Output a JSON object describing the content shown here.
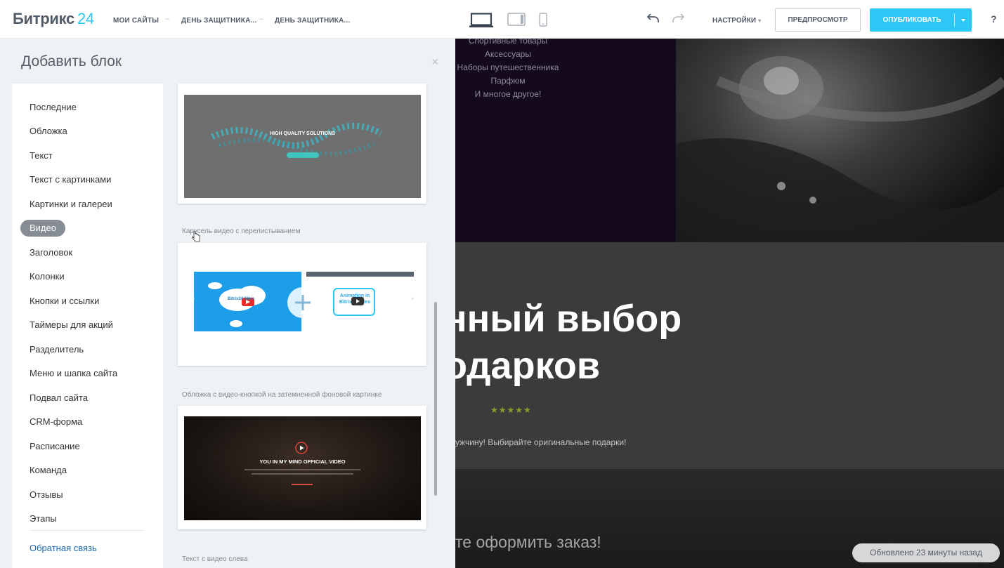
{
  "header": {
    "brand_name": "Битрикс",
    "brand_suffix": "24",
    "breadcrumbs": [
      "МОИ САЙТЫ",
      "ДЕНЬ ЗАЩИТНИКА...",
      "ДЕНЬ ЗАЩИТНИКА..."
    ],
    "settings_label": "НАСТРОЙКИ",
    "preview_label": "ПРЕДПРОСМОТР",
    "publish_label": "ОПУБЛИКОВАТЬ",
    "help_label": "?",
    "devices": [
      "desktop-icon",
      "tablet-icon",
      "mobile-icon"
    ]
  },
  "panel": {
    "title": "Добавить блок",
    "close": "×",
    "categories": [
      "Последние",
      "Обложка",
      "Текст",
      "Текст с картинками",
      "Картинки и галереи",
      "Видео",
      "Заголовок",
      "Колонки",
      "Кнопки и ссылки",
      "Таймеры для акций",
      "Разделитель",
      "Меню и шапка сайта",
      "Подвал сайта",
      "CRM-форма",
      "Расписание",
      "Команда",
      "Отзывы",
      "Этапы"
    ],
    "active_category": "Видео",
    "feedback": "Обратная связь",
    "blocks": [
      {
        "title": "",
        "preview_heading": "HIGH QUALITY SOLUTIONS"
      },
      {
        "title": "Карусель видео с перелистыванием",
        "slide1": "Bitrix24 Sites",
        "slide2_line1": "Animation in",
        "slide2_line2": "Bitrix24 Sites"
      },
      {
        "title": "Обложка с видео-кнопкой на затемненной фоновой картинке",
        "preview_heading": "YOU IN MY MIND OFFICIAL VIDEO"
      },
      {
        "title": "Текст с видео слева"
      }
    ]
  },
  "site": {
    "list_items": [
      "Спортивные товары",
      "Аксессуары",
      "Наборы путешественника",
      "Парфюм",
      "И многое другое!"
    ],
    "heading_line1": "нный выбор",
    "heading_line2": "одарков",
    "stars": "★★★★★",
    "paragraph": "ужчину! Выбирайте оригинальные подарки!",
    "cta": "те оформить заказ!"
  },
  "status": {
    "updated": "Обновлено 23 минуты назад"
  },
  "colors": {
    "accent": "#2fc6f6",
    "active_category": "#858c94",
    "link": "#2067b0"
  }
}
